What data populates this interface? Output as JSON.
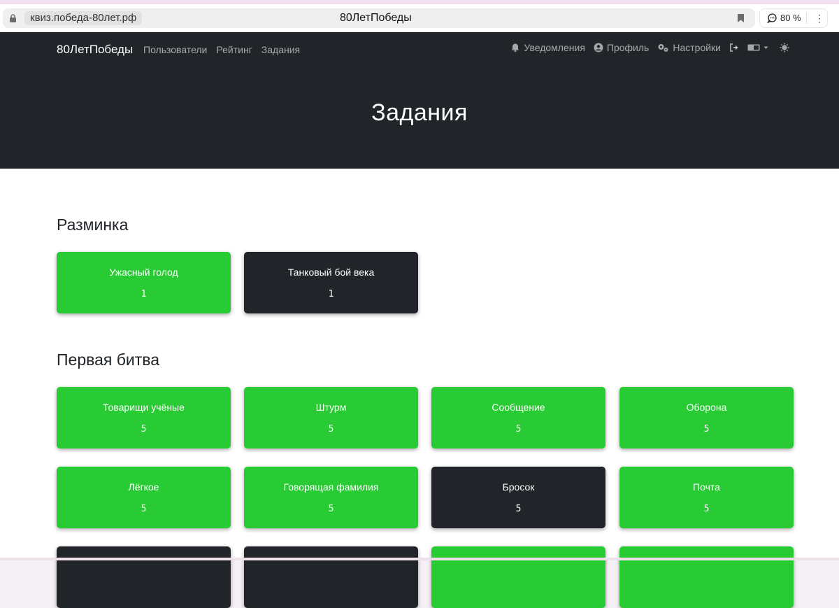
{
  "browser": {
    "url": "квиз.победа-80лет.рф",
    "page_title": "80ЛетПобеды",
    "zoom": "80 %",
    "menu_icon": "⋮"
  },
  "navbar": {
    "brand": "80ЛетПобеды",
    "links": [
      "Пользователи",
      "Рейтинг",
      "Задания"
    ],
    "notifications": "Уведомления",
    "profile": "Профиль",
    "settings": "Настройки"
  },
  "hero": {
    "title": "Задания"
  },
  "sections": [
    {
      "title": "Разминка",
      "challenges": [
        {
          "name": "Ужасный голод",
          "points": "1",
          "status": "solved"
        },
        {
          "name": "Танковый бой века",
          "points": "1",
          "status": "unsolved"
        }
      ]
    },
    {
      "title": "Первая битва",
      "challenges": [
        {
          "name": "Товарищи учёные",
          "points": "5",
          "status": "solved"
        },
        {
          "name": "Штурм",
          "points": "5",
          "status": "solved"
        },
        {
          "name": "Сообщение",
          "points": "5",
          "status": "solved"
        },
        {
          "name": "Оборона",
          "points": "5",
          "status": "solved"
        },
        {
          "name": "Лёгкое",
          "points": "5",
          "status": "solved"
        },
        {
          "name": "Говорящая фамилия",
          "points": "5",
          "status": "solved"
        },
        {
          "name": "Бросок",
          "points": "5",
          "status": "unsolved"
        },
        {
          "name": "Почта",
          "points": "5",
          "status": "solved"
        }
      ],
      "partial_row_status": [
        "unsolved",
        "unsolved",
        "solved",
        "solved"
      ]
    }
  ],
  "colors": {
    "solved": "#28cb33",
    "unsolved": "#212529",
    "navbar": "#212529"
  }
}
